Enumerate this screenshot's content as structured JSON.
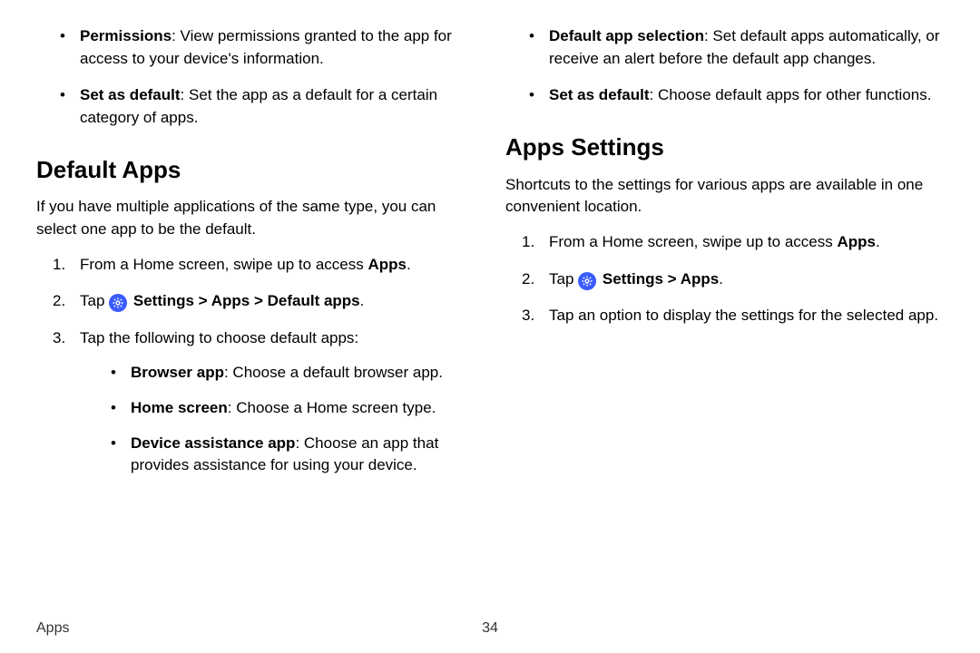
{
  "left": {
    "top_bullets": [
      {
        "term": "Permissions",
        "desc": ": View permissions granted to the app for access to your device's information."
      },
      {
        "term": "Set as default",
        "desc": ": Set the app as a default for a certain category of apps."
      }
    ],
    "heading": "Default Apps",
    "intro": "If you have multiple applications of the same type, you can select one app to be the default.",
    "step1_pre": "From a Home screen, swipe up to access ",
    "step1_bold": "Apps",
    "step1_post": ".",
    "step2_tap": "Tap ",
    "step2_settings": "Settings",
    "step2_apps": "Apps",
    "step2_default": "Default apps",
    "step3": "Tap the following to choose default apps:",
    "sub_bullets": [
      {
        "term": "Browser app",
        "desc": ": Choose a default browser app."
      },
      {
        "term": "Home screen",
        "desc": ": Choose a Home screen type."
      },
      {
        "term": "Device assistance app",
        "desc": ": Choose an app that provides assistance for using your device."
      }
    ]
  },
  "right": {
    "top_bullets": [
      {
        "term": "Default app selection",
        "desc": ": Set default apps automatically, or receive an alert before the default app changes."
      },
      {
        "term": "Set as default",
        "desc": ": Choose default apps for other functions."
      }
    ],
    "heading": "Apps Settings",
    "intro": "Shortcuts to the settings for various apps are available in one convenient location.",
    "step1_pre": "From a Home screen, swipe up to access ",
    "step1_bold": "Apps",
    "step1_post": ".",
    "step2_tap": "Tap ",
    "step2_settings": "Settings",
    "step2_apps": "Apps",
    "step3": "Tap an option to display the settings for the selected app."
  },
  "chevron": ">",
  "dot": ".",
  "footer": {
    "breadcrumb": "Apps",
    "page_num": "34"
  }
}
